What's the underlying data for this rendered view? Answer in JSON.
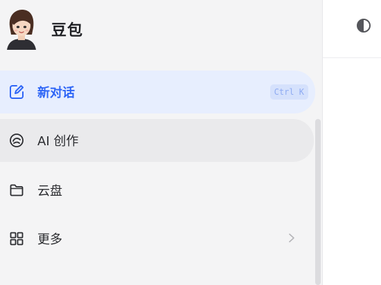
{
  "app": {
    "name": "豆包"
  },
  "sidebar": {
    "items": [
      {
        "label": "新对话",
        "shortcut": "Ctrl K",
        "icon": "new-chat-icon",
        "state": "active"
      },
      {
        "label": "AI 创作",
        "icon": "ai-create-icon",
        "state": "hover"
      },
      {
        "label": "云盘",
        "icon": "folder-icon"
      },
      {
        "label": "更多",
        "icon": "grid-icon",
        "has_submenu": true
      }
    ]
  },
  "colors": {
    "accent": "#2f66f6",
    "active_bg": "#e7eefe",
    "hover_bg": "#eaeaec",
    "sidebar_bg": "#f4f4f5"
  }
}
